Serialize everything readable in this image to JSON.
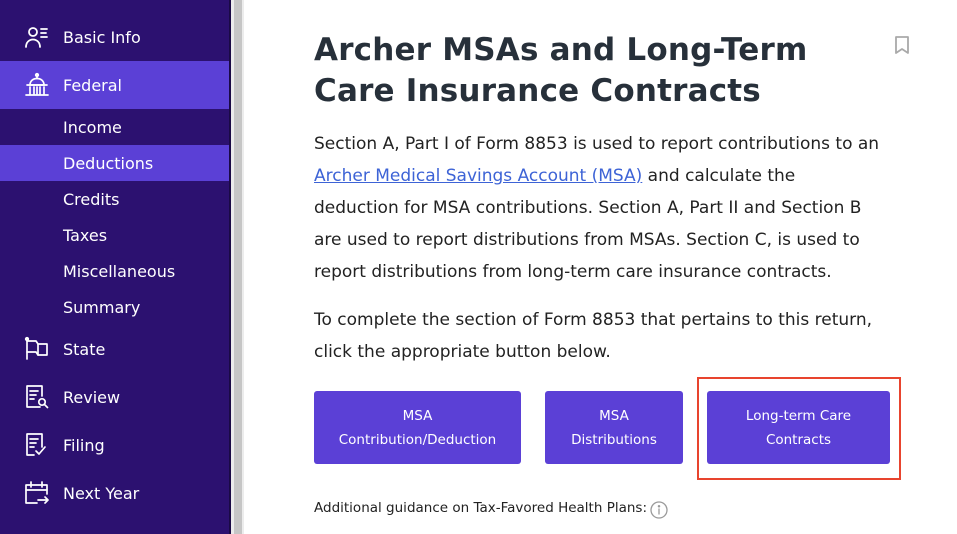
{
  "sidebar": {
    "items": [
      {
        "label": "Basic Info",
        "icon": "person-list-icon",
        "active": false
      },
      {
        "label": "Federal",
        "icon": "capitol-building-icon",
        "active": true
      },
      {
        "label": "State",
        "icon": "flag-icon",
        "active": false
      },
      {
        "label": "Review",
        "icon": "document-search-icon",
        "active": false
      },
      {
        "label": "Filing",
        "icon": "document-check-icon",
        "active": false
      },
      {
        "label": "Next Year",
        "icon": "calendar-arrow-icon",
        "active": false
      }
    ],
    "federal_subitems": [
      {
        "label": "Income",
        "active": false
      },
      {
        "label": "Deductions",
        "active": true
      },
      {
        "label": "Credits",
        "active": false
      },
      {
        "label": "Taxes",
        "active": false
      },
      {
        "label": "Miscellaneous",
        "active": false
      },
      {
        "label": "Summary",
        "active": false
      }
    ]
  },
  "main": {
    "title": "Archer MSAs and Long-Term Care Insurance Contracts",
    "bookmark_icon": "bookmark-icon",
    "para1": {
      "before_link": "Section A, Part I of Form 8853 is used to report contributions to an ",
      "link": "Archer Medical Savings Account (MSA)",
      "after_link": " and calculate the deduction for MSA contributions. Section A, Part II and Section B are used to report distributions from MSAs. Section C, is used to report distributions from long-term care insurance contracts."
    },
    "para2": "To complete the section of Form 8853 that pertains to this return, click the appropriate button below.",
    "buttons": [
      {
        "line1": "MSA",
        "line2": "Contribution/Deduction"
      },
      {
        "line1": "MSA",
        "line2": "Distributions"
      },
      {
        "line1": "Long-term Care",
        "line2": "Contracts"
      }
    ],
    "guidance_label": "Additional guidance on Tax-Favored Health Plans:",
    "info_icon": "info-icon"
  },
  "colors": {
    "sidebar_bg": "#2c1170",
    "accent": "#5b40d6",
    "link": "#3d63d6",
    "highlight_border": "#e8442e",
    "title_text": "#27303a"
  }
}
